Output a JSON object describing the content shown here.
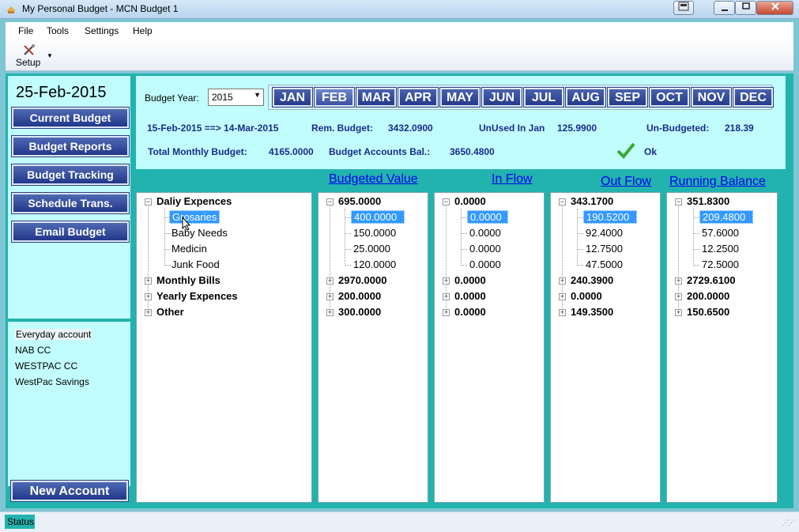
{
  "window": {
    "title": "My Personal Budget - MCN Budget 1"
  },
  "menu": [
    "File",
    "Tools",
    "Settings",
    "Help"
  ],
  "toolbar": {
    "setup_label": "Setup"
  },
  "sidebar": {
    "date": "25-Feb-2015",
    "nav": [
      "Current Budget",
      "Budget Reports",
      "Budget Tracking",
      "Schedule Trans.",
      "Email Budget"
    ],
    "accounts": [
      "Everyday account",
      "NAB CC",
      "WESTPAC CC",
      "WestPac Savings"
    ],
    "new_account": "New Account"
  },
  "header": {
    "budget_year_label": "Budget Year:",
    "budget_year": "2015",
    "months": [
      "JAN",
      "FEB",
      "MAR",
      "APR",
      "MAY",
      "JUN",
      "JUL",
      "AUG",
      "SEP",
      "OCT",
      "NOV",
      "DEC"
    ],
    "active_month": "FEB",
    "period": "15-Feb-2015 ==> 14-Mar-2015",
    "rem_budget_label": "Rem. Budget:",
    "rem_budget": "3432.0900",
    "unused_label": "UnUsed In Jan",
    "unused": "125.9900",
    "unbudgeted_label": "Un-Budgeted:",
    "unbudgeted": "218.39",
    "total_monthly_label": "Total Monthly Budget:",
    "total_monthly": "4165.0000",
    "accounts_bal_label": "Budget Accounts Bal.:",
    "accounts_bal": "3650.4800",
    "status_ok": "Ok"
  },
  "columns": {
    "budgeted": "Budgeted Value",
    "inflow": "In Flow",
    "outflow": "Out Flow",
    "running": "Running Balance"
  },
  "tree": {
    "categories": [
      {
        "name": "Daliy Expences",
        "budgeted": "695.0000",
        "inflow": "0.0000",
        "outflow": "343.1700",
        "running": "351.8300",
        "children": [
          {
            "name": "Grosaries",
            "budgeted": "400.0000",
            "inflow": "0.0000",
            "outflow": "190.5200",
            "running": "209.4800"
          },
          {
            "name": "Baby Needs",
            "budgeted": "150.0000",
            "inflow": "0.0000",
            "outflow": "92.4000",
            "running": "57.6000"
          },
          {
            "name": "Medicin",
            "budgeted": "25.0000",
            "inflow": "0.0000",
            "outflow": "12.7500",
            "running": "12.2500"
          },
          {
            "name": "Junk Food",
            "budgeted": "120.0000",
            "inflow": "0.0000",
            "outflow": "47.5000",
            "running": "72.5000"
          }
        ]
      },
      {
        "name": "Monthly Bills",
        "budgeted": "2970.0000",
        "inflow": "0.0000",
        "outflow": "240.3900",
        "running": "2729.6100"
      },
      {
        "name": "Yearly Expences",
        "budgeted": "200.0000",
        "inflow": "0.0000",
        "outflow": "0.0000",
        "running": "200.0000"
      },
      {
        "name": "Other",
        "budgeted": "300.0000",
        "inflow": "0.0000",
        "outflow": "149.3500",
        "running": "150.6500"
      }
    ]
  },
  "statusbar": {
    "text": "Status"
  },
  "colors": {
    "teal": "#22b3ae",
    "panel": "#c2fdfd",
    "button": "#253a8c",
    "label_blue": "#1a2b8c",
    "selection": "#3399ff"
  }
}
